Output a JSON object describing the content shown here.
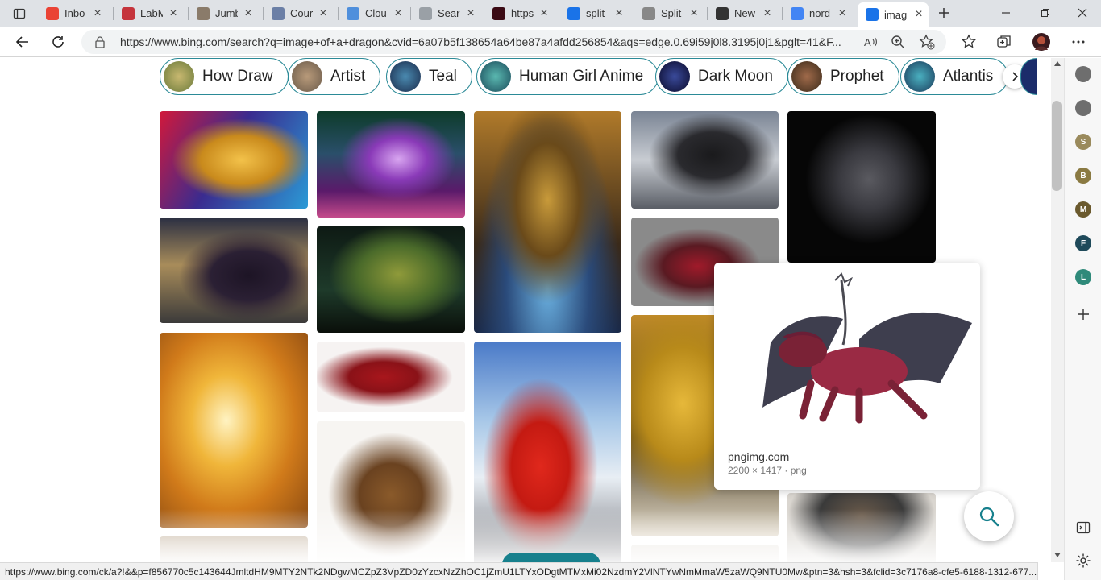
{
  "tabs": [
    {
      "title": "Inbo",
      "favicon": "gmail-icon",
      "color": "#ea4335"
    },
    {
      "title": "LabM",
      "favicon": "pdf-icon",
      "color": "#c5343c"
    },
    {
      "title": "Jumb",
      "favicon": "jumbo-icon",
      "color": "#8a7b6a"
    },
    {
      "title": "Cour",
      "favicon": "course-icon",
      "color": "#6b7fa6"
    },
    {
      "title": "Clou",
      "favicon": "cloud-icon",
      "color": "#4f8fdc"
    },
    {
      "title": "Sear",
      "favicon": "gear-icon",
      "color": "#9aa0a6"
    },
    {
      "title": "https",
      "favicon": "dark-tile-icon",
      "color": "#3b0a14"
    },
    {
      "title": "split",
      "favicon": "search-icon",
      "color": "#1a73e8"
    },
    {
      "title": "Split",
      "favicon": "image-icon",
      "color": "#888888"
    },
    {
      "title": "New",
      "favicon": "newtab-icon",
      "color": "#333333"
    },
    {
      "title": "nord",
      "favicon": "google-icon",
      "color": "#4285f4"
    },
    {
      "title": "imag",
      "favicon": "search-icon",
      "color": "#1a73e8"
    }
  ],
  "address": {
    "url": "https://www.bing.com/search?q=image+of+a+dragon&cvid=6a07b5f138654a64be87a4afdd256854&aqs=edge.0.69i59j0l8.3195j0j1&pglt=41&F..."
  },
  "chips": [
    "How Draw",
    "Artist",
    "Teal",
    "Human Girl Anime",
    "Dark Moon",
    "Prophet",
    "Atlantis"
  ],
  "hover_card": {
    "site": "pngimg.com",
    "meta": "2200 × 1417 · png"
  },
  "sidebar": [
    {
      "letter": "",
      "color": "#6e6e6e"
    },
    {
      "letter": "",
      "color": "#6e6e6e"
    },
    {
      "letter": "S",
      "color": "#9a8a5c"
    },
    {
      "letter": "B",
      "color": "#8a7a42"
    },
    {
      "letter": "M",
      "color": "#6b5a2e"
    },
    {
      "letter": "F",
      "color": "#1f4a5a"
    },
    {
      "letter": "L",
      "color": "#2f8a7a"
    }
  ],
  "status_url": "https://www.bing.com/ck/a?!&&p=f856770c5c143644JmltdHM9MTY2NTk2NDgwMCZpZ3VpZD0zYzcxNzZhOC1jZmU1LTYxODgtMTMxMi02NzdmY2VlNTYwNmMmaW5zaWQ9NTU0Mw&ptn=3&hsh=3&fclid=3c7176a8-cfe5-6188-1312-677..."
}
